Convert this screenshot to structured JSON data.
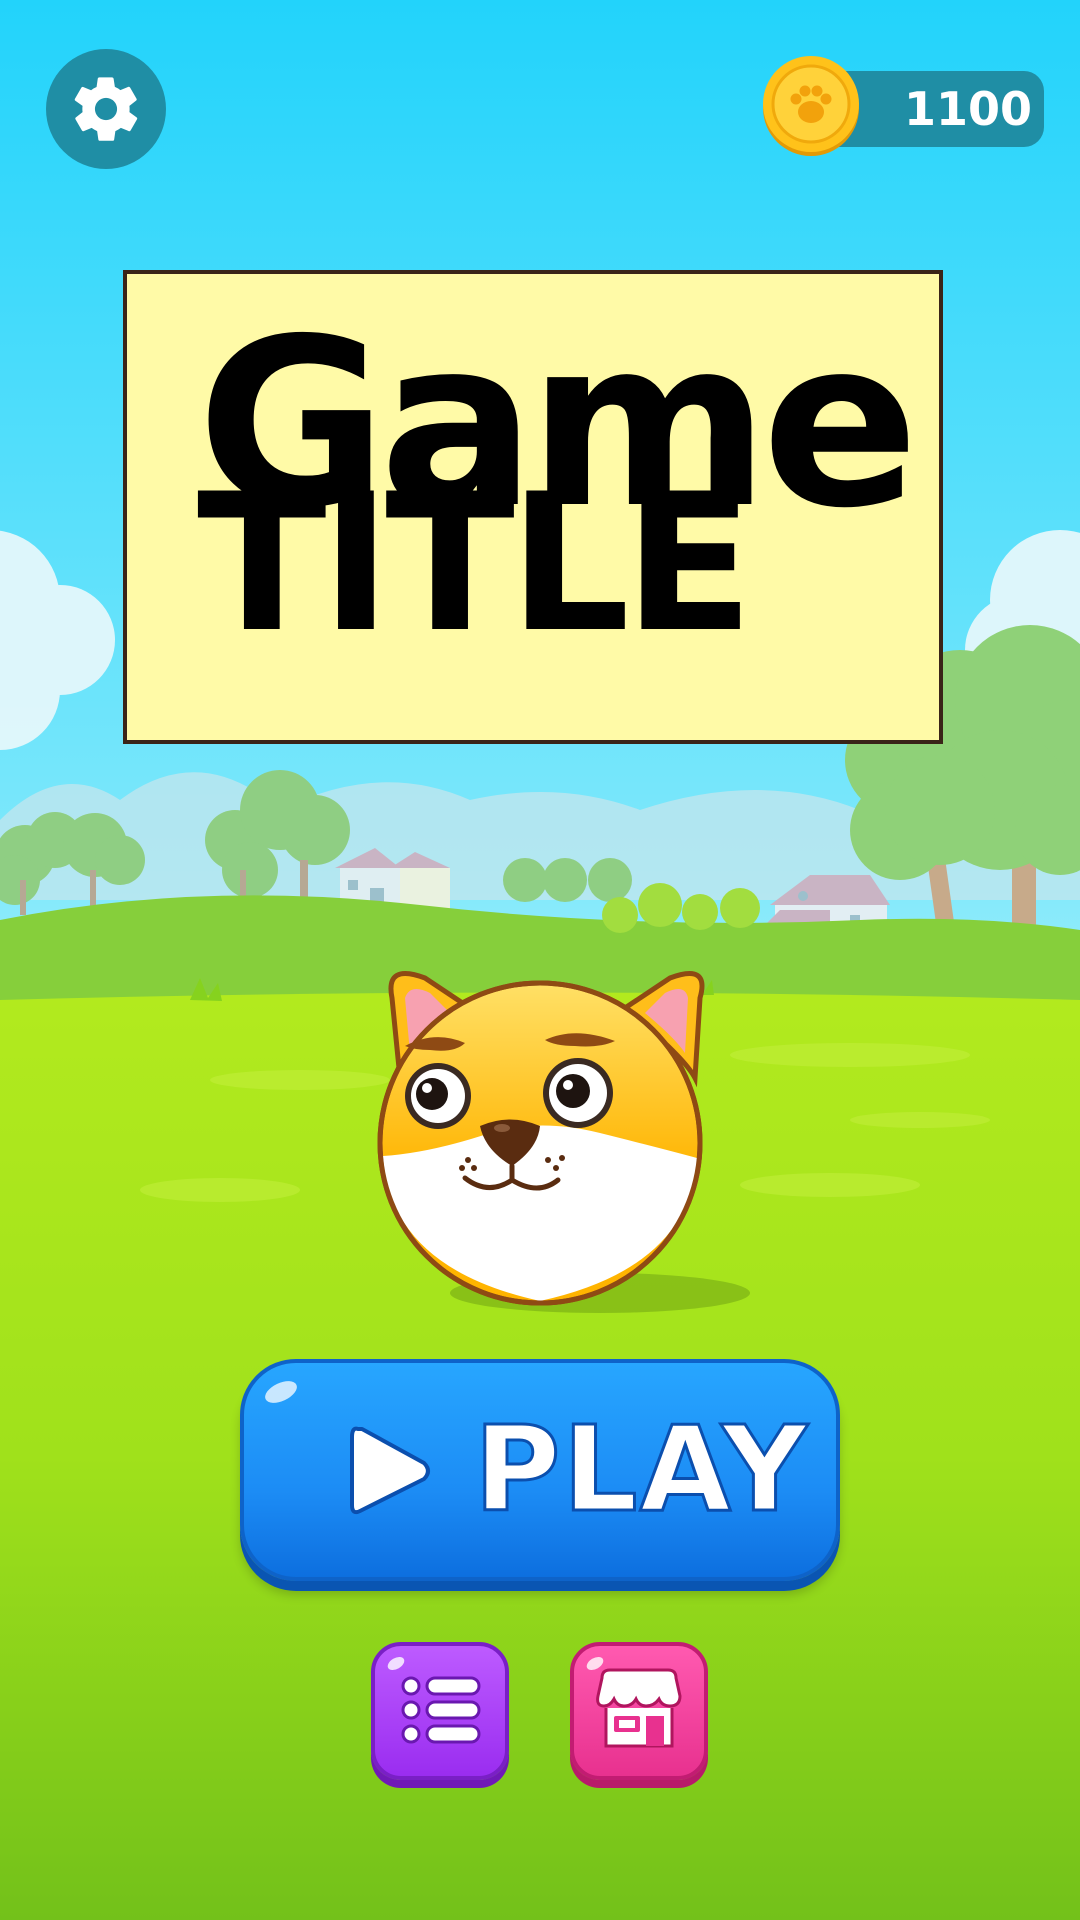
{
  "hud": {
    "settings_icon": "gear-icon",
    "coin_icon": "paw-coin-icon",
    "coins": "1100"
  },
  "title": {
    "line1": "Game",
    "line2": "TITLE"
  },
  "character": {
    "icon": "shiba-dog-character"
  },
  "menu": {
    "play_label": "PLAY",
    "play_icon": "play-triangle-icon",
    "list_icon": "list-icon",
    "shop_icon": "shop-icon"
  },
  "colors": {
    "sky_top": "#22d3fb",
    "grass": "#9fe31c",
    "play_button": "#1c8cf5",
    "list_button": "#a935f5",
    "shop_button": "#f0409e",
    "hud_pill": "#1f8ea5",
    "title_box": "#fffaa7"
  }
}
